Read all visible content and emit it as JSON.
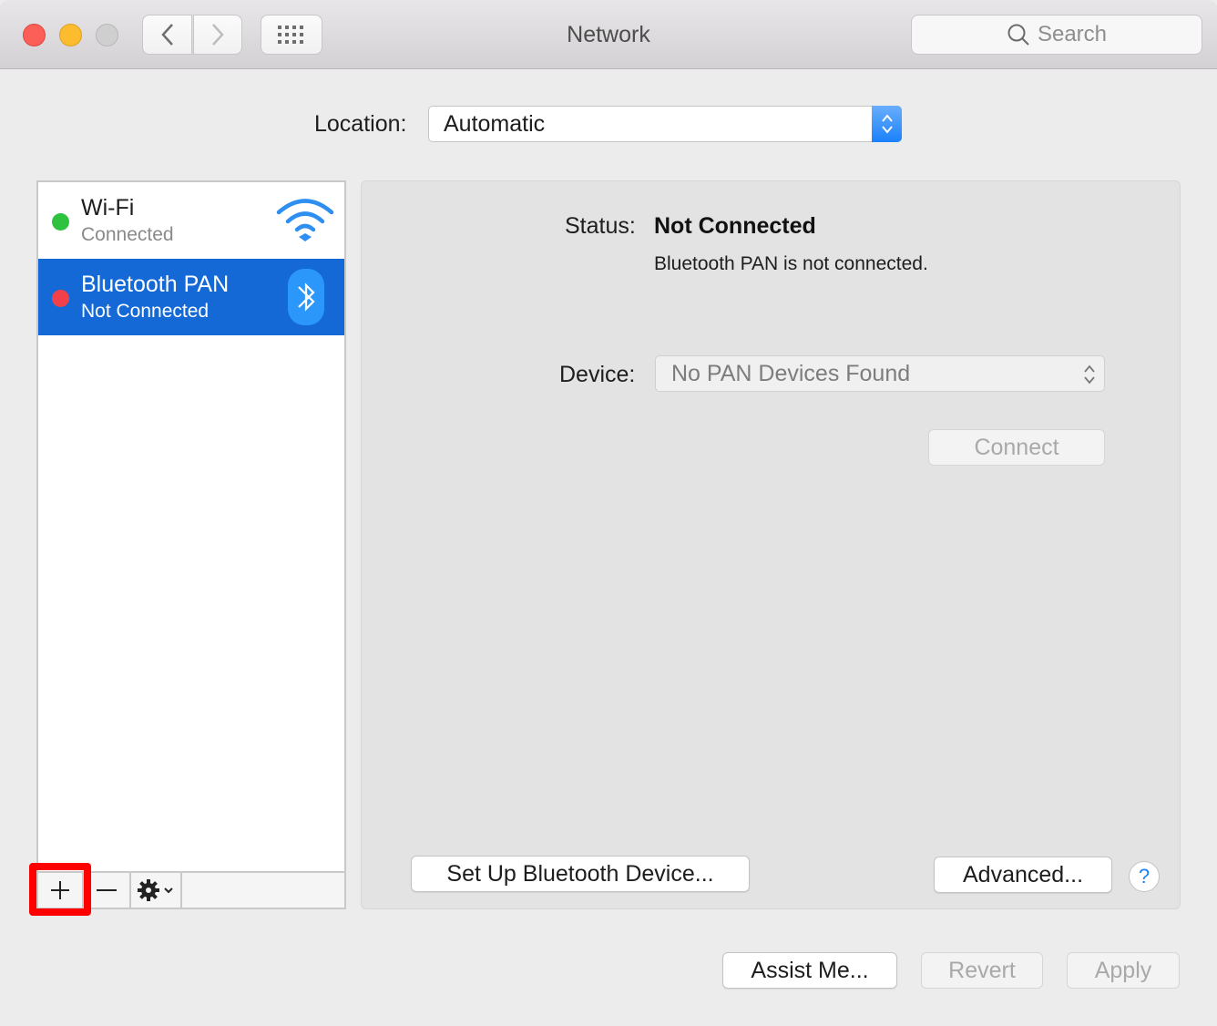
{
  "window": {
    "title": "Network",
    "traffic_lights": [
      "close",
      "minimize",
      "zoom"
    ],
    "search": {
      "placeholder": "Search",
      "icon": "search-icon"
    },
    "nav": {
      "back_icon": "chevron-left-icon",
      "forward_icon": "chevron-right-icon",
      "grid_icon": "grid-icon"
    }
  },
  "location": {
    "label": "Location:",
    "value": "Automatic"
  },
  "services": [
    {
      "name": "Wi-Fi",
      "status": "Connected",
      "status_color": "#2fc240",
      "icon": "wifi-icon",
      "selected": false
    },
    {
      "name": "Bluetooth PAN",
      "status": "Not Connected",
      "status_color": "#f2404a",
      "icon": "bluetooth-icon",
      "selected": true
    }
  ],
  "sidebar_toolbar": {
    "add": "+",
    "remove": "−",
    "gear_icon": "gear-icon"
  },
  "detail": {
    "status_label": "Status:",
    "status_value": "Not Connected",
    "status_description": "Bluetooth PAN is not connected.",
    "device_label": "Device:",
    "device_value": "No PAN Devices Found",
    "connect_label": "Connect",
    "setup_label": "Set Up Bluetooth Device...",
    "advanced_label": "Advanced...",
    "help_label": "?"
  },
  "footer": {
    "assist_label": "Assist Me...",
    "revert_label": "Revert",
    "apply_label": "Apply"
  },
  "colors": {
    "accent": "#1469d7",
    "highlight": "#ff0000"
  }
}
